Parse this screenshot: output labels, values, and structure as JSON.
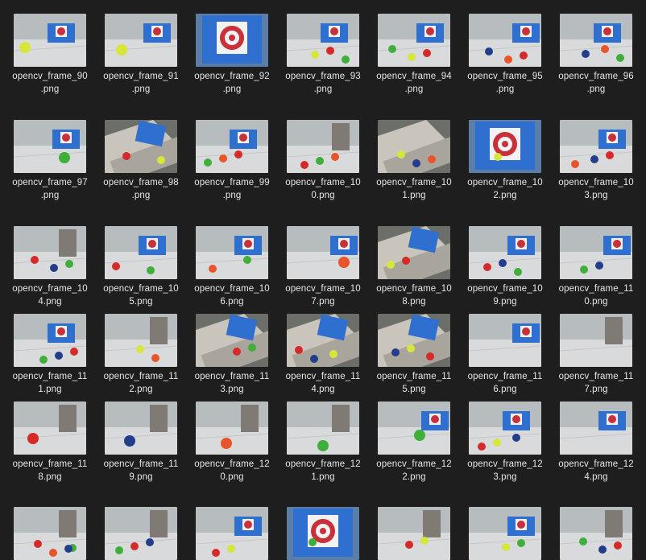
{
  "explorer": {
    "files": [
      {
        "name": "opencv_frame_90\n.png",
        "scene": "floor",
        "box": "blue",
        "balls": [
          "yellow"
        ]
      },
      {
        "name": "opencv_frame_91\n.png",
        "scene": "floor",
        "box": "blue",
        "balls": [
          "yellow"
        ]
      },
      {
        "name": "opencv_frame_92\n.png",
        "scene": "closeup",
        "box": "blue",
        "balls": []
      },
      {
        "name": "opencv_frame_93\n.png",
        "scene": "floor",
        "box": "blue",
        "balls": [
          "yellow",
          "red",
          "green"
        ]
      },
      {
        "name": "opencv_frame_94\n.png",
        "scene": "floor",
        "box": "blue",
        "balls": [
          "yellow",
          "red",
          "green"
        ]
      },
      {
        "name": "opencv_frame_95\n.png",
        "scene": "floor",
        "box": "blue",
        "balls": [
          "orange",
          "red",
          "blue"
        ]
      },
      {
        "name": "opencv_frame_96\n.png",
        "scene": "floor",
        "box": "blue",
        "balls": [
          "orange",
          "green",
          "blue"
        ]
      },
      {
        "name": "opencv_frame_97\n.png",
        "scene": "floor",
        "box": "blue",
        "balls": [
          "green"
        ]
      },
      {
        "name": "opencv_frame_98\n.png",
        "scene": "tilted",
        "box": "blue",
        "balls": [
          "yellow",
          "red"
        ]
      },
      {
        "name": "opencv_frame_99\n.png",
        "scene": "floor",
        "box": "blue",
        "balls": [
          "green",
          "orange",
          "red"
        ]
      },
      {
        "name": "opencv_frame_10\n0.png",
        "scene": "floor",
        "box": "none",
        "balls": [
          "red",
          "green",
          "orange"
        ]
      },
      {
        "name": "opencv_frame_10\n1.png",
        "scene": "tilted",
        "box": "none",
        "balls": [
          "yellow",
          "blue",
          "orange"
        ]
      },
      {
        "name": "opencv_frame_10\n2.png",
        "scene": "closeup",
        "box": "blue",
        "balls": [
          "yellow"
        ]
      },
      {
        "name": "opencv_frame_10\n3.png",
        "scene": "floor",
        "box": "blue",
        "balls": [
          "blue",
          "red",
          "orange"
        ]
      },
      {
        "name": "opencv_frame_10\n4.png",
        "scene": "floor",
        "box": "none",
        "balls": [
          "blue",
          "green",
          "red"
        ]
      },
      {
        "name": "opencv_frame_10\n5.png",
        "scene": "floor",
        "box": "blue",
        "balls": [
          "green",
          "red"
        ]
      },
      {
        "name": "opencv_frame_10\n6.png",
        "scene": "floor",
        "box": "blue",
        "balls": [
          "green",
          "orange"
        ]
      },
      {
        "name": "opencv_frame_10\n7.png",
        "scene": "floor",
        "box": "blue",
        "balls": [
          "orange"
        ]
      },
      {
        "name": "opencv_frame_10\n8.png",
        "scene": "tilted",
        "box": "blue",
        "balls": [
          "yellow",
          "red"
        ]
      },
      {
        "name": "opencv_frame_10\n9.png",
        "scene": "floor",
        "box": "blue",
        "balls": [
          "red",
          "blue",
          "green"
        ]
      },
      {
        "name": "opencv_frame_11\n0.png",
        "scene": "floor",
        "box": "blue",
        "balls": [
          "green",
          "blue"
        ]
      },
      {
        "name": "opencv_frame_11\n1.png",
        "scene": "floor",
        "box": "blue",
        "balls": [
          "green",
          "blue",
          "red"
        ]
      },
      {
        "name": "opencv_frame_11\n2.png",
        "scene": "floor",
        "box": "none",
        "balls": [
          "yellow",
          "orange"
        ]
      },
      {
        "name": "opencv_frame_11\n3.png",
        "scene": "tilted",
        "box": "blue",
        "balls": [
          "red",
          "green"
        ]
      },
      {
        "name": "opencv_frame_11\n4.png",
        "scene": "tilted",
        "box": "blue",
        "balls": [
          "yellow",
          "red",
          "blue"
        ]
      },
      {
        "name": "opencv_frame_11\n5.png",
        "scene": "tilted",
        "box": "blue",
        "balls": [
          "red",
          "blue",
          "yellow"
        ]
      },
      {
        "name": "opencv_frame_11\n6.png",
        "scene": "floor",
        "box": "blue",
        "balls": []
      },
      {
        "name": "opencv_frame_11\n7.png",
        "scene": "floor",
        "box": "none",
        "balls": []
      },
      {
        "name": "opencv_frame_11\n8.png",
        "scene": "floor",
        "box": "none",
        "balls": [
          "red"
        ]
      },
      {
        "name": "opencv_frame_11\n9.png",
        "scene": "floor",
        "box": "none",
        "balls": [
          "blue"
        ]
      },
      {
        "name": "opencv_frame_12\n0.png",
        "scene": "floor",
        "box": "none",
        "balls": [
          "orange"
        ]
      },
      {
        "name": "opencv_frame_12\n1.png",
        "scene": "floor",
        "box": "none",
        "balls": [
          "green"
        ]
      },
      {
        "name": "opencv_frame_12\n2.png",
        "scene": "floor",
        "box": "blue",
        "balls": [
          "green"
        ]
      },
      {
        "name": "opencv_frame_12\n3.png",
        "scene": "floor",
        "box": "blue",
        "balls": [
          "blue",
          "red",
          "yellow"
        ]
      },
      {
        "name": "opencv_frame_12\n4.png",
        "scene": "floor",
        "box": "blue",
        "balls": []
      },
      {
        "name": "",
        "scene": "floor",
        "box": "none",
        "balls": [
          "green",
          "red",
          "orange",
          "blue"
        ]
      },
      {
        "name": "",
        "scene": "floor",
        "box": "none",
        "balls": [
          "green",
          "red",
          "blue"
        ]
      },
      {
        "name": "",
        "scene": "floor",
        "box": "blue",
        "balls": [
          "red",
          "yellow"
        ]
      },
      {
        "name": "",
        "scene": "closeup",
        "box": "blue",
        "balls": [
          "green"
        ]
      },
      {
        "name": "",
        "scene": "floor",
        "box": "none",
        "balls": [
          "red",
          "yellow"
        ]
      },
      {
        "name": "",
        "scene": "floor",
        "box": "blue",
        "balls": [
          "yellow",
          "green"
        ]
      },
      {
        "name": "",
        "scene": "floor",
        "box": "none",
        "balls": [
          "blue",
          "red",
          "green"
        ]
      }
    ],
    "colors": {
      "background": "#1e1e1e",
      "label": "#e6e6e6",
      "box_blue": "#2f6fd0",
      "target_red": "#c8303a",
      "ball_yellow": "#d6e63a",
      "ball_green": "#3fae3a",
      "ball_red": "#d62a2a",
      "ball_orange": "#e8552a",
      "ball_blue": "#243c8c"
    }
  }
}
